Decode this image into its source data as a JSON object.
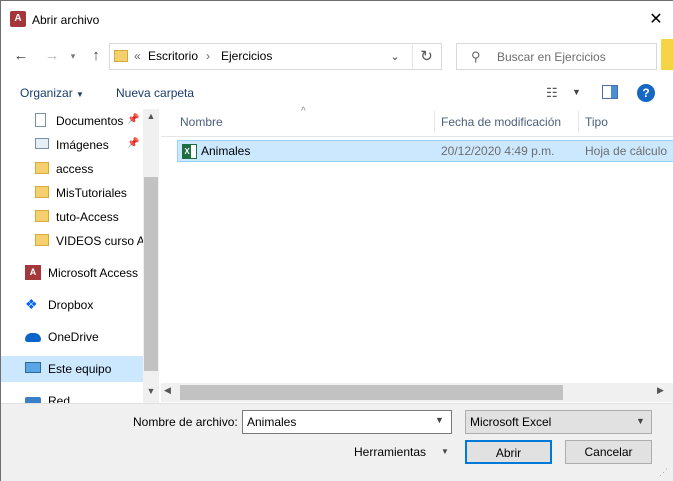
{
  "window": {
    "title": "Abrir archivo",
    "app_icon": "access-icon",
    "close_glyph": "✕"
  },
  "address": {
    "crumbs": [
      "Escritorio",
      "Ejercicios"
    ],
    "overflow": "«",
    "separator": "›"
  },
  "search": {
    "placeholder": "Buscar en Ejercicios"
  },
  "toolbar": {
    "organize_label": "Organizar",
    "new_folder_label": "Nueva carpeta"
  },
  "nav": {
    "quick_items": [
      {
        "label": "Documentos",
        "icon": "document-icon",
        "pinned": true
      },
      {
        "label": "Imágenes",
        "icon": "pictures-icon",
        "pinned": true
      },
      {
        "label": "access",
        "icon": "folder-icon",
        "pinned": false
      },
      {
        "label": "MisTutoriales",
        "icon": "folder-icon",
        "pinned": false
      },
      {
        "label": "tuto-Access",
        "icon": "folder-icon",
        "pinned": false
      },
      {
        "label": "VIDEOS curso Ac",
        "icon": "folder-icon",
        "pinned": false
      }
    ],
    "roots": [
      {
        "label": "Microsoft Access",
        "icon": "access-icon"
      },
      {
        "label": "Dropbox",
        "icon": "dropbox-icon"
      },
      {
        "label": "OneDrive",
        "icon": "onedrive-icon"
      },
      {
        "label": "Este equipo",
        "icon": "computer-icon",
        "selected": true
      },
      {
        "label": "Red",
        "icon": "network-icon"
      }
    ]
  },
  "list": {
    "columns": [
      "Nombre",
      "Fecha de modificación",
      "Tipo"
    ],
    "rows": [
      {
        "name": "Animales",
        "date": "20/12/2020 4:49 p.m.",
        "type": "Hoja de cálculo",
        "icon": "excel-file-icon",
        "selected": true
      }
    ]
  },
  "footer": {
    "filename_label": "Nombre de archivo:",
    "filename_value": "Animales",
    "filetype_value": "Microsoft Excel",
    "tools_label": "Herramientas",
    "open_label": "Abrir",
    "cancel_label": "Cancelar"
  },
  "colors": {
    "selection": "#cce8ff",
    "accent": "#0078d7",
    "access_red": "#a4373a",
    "excel_green": "#1d6f42"
  }
}
